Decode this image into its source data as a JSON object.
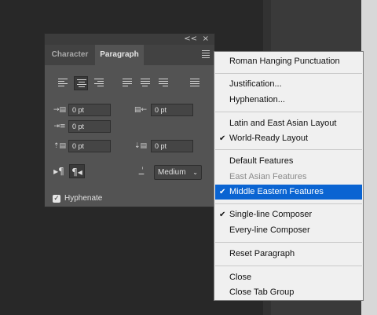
{
  "panel": {
    "tabs": [
      "Character",
      "Paragraph"
    ],
    "collapse_icon": "<<",
    "close_icon": "×",
    "fields": {
      "left_indent": "0 pt",
      "right_indent": "0 pt",
      "first_line_indent": "0 pt",
      "space_before": "0 pt",
      "space_after": "0 pt"
    },
    "kashida_select": "Medium",
    "hyphenate_label": "Hyphenate",
    "hyphenate_checked": true,
    "direction_icons": [
      "ltr-paragraph-icon",
      "rtl-paragraph-icon"
    ],
    "align_icons": [
      "align-left",
      "align-center",
      "align-right",
      "justify-last-left",
      "justify-last-center",
      "justify-last-right",
      "justify-all"
    ]
  },
  "menu": {
    "items": [
      {
        "label": "Roman Hanging Punctuation",
        "checked": false
      },
      {
        "label": "Justification...",
        "checked": false
      },
      {
        "label": "Hyphenation...",
        "checked": false
      },
      {
        "label": "Latin and East Asian Layout",
        "checked": false
      },
      {
        "label": "World-Ready Layout",
        "checked": true
      },
      {
        "label": "Default Features",
        "checked": false
      },
      {
        "label": "East Asian Features",
        "checked": false,
        "disabled": true
      },
      {
        "label": "Middle Eastern Features",
        "checked": true,
        "highlighted": true
      },
      {
        "label": "Single-line Composer",
        "checked": true
      },
      {
        "label": "Every-line Composer",
        "checked": false
      },
      {
        "label": "Reset Paragraph",
        "checked": false
      },
      {
        "label": "Close",
        "checked": false
      },
      {
        "label": "Close Tab Group",
        "checked": false
      }
    ]
  },
  "colors": {
    "highlight": "#0a64d2",
    "panel_bg": "#535353",
    "menu_bg": "#f0f0f0"
  }
}
